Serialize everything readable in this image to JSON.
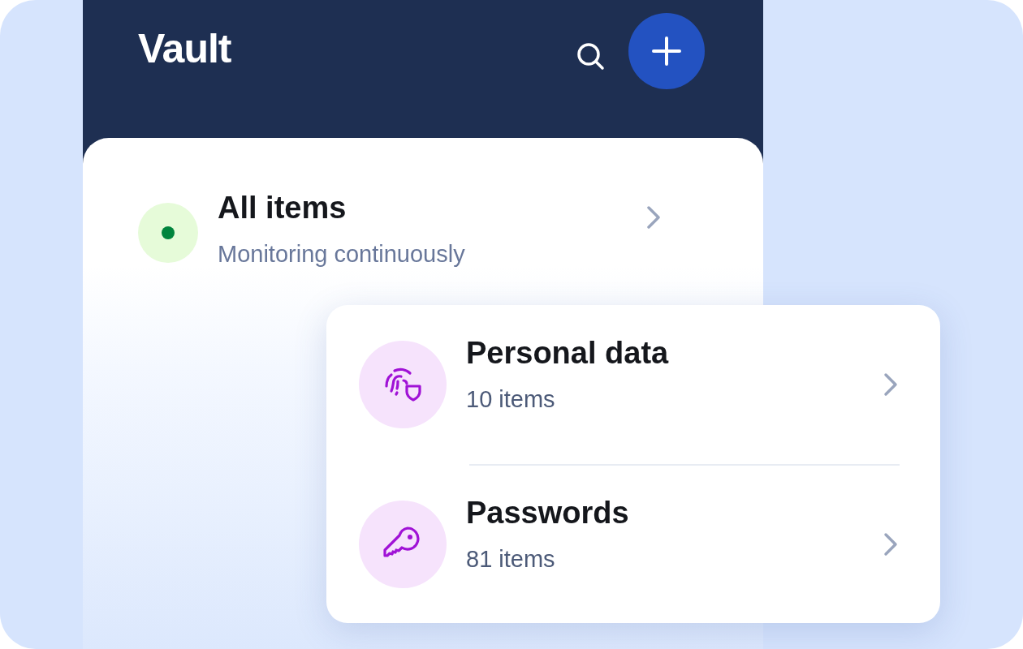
{
  "header": {
    "title": "Vault"
  },
  "summary": {
    "title": "All items",
    "subtitle": "Monitoring continuously",
    "color": "#00843d"
  },
  "categories": [
    {
      "kind": "fingerprint",
      "title": "Personal data",
      "count": "10 items"
    },
    {
      "kind": "key",
      "title": "Passwords",
      "count": "81 items"
    }
  ]
}
